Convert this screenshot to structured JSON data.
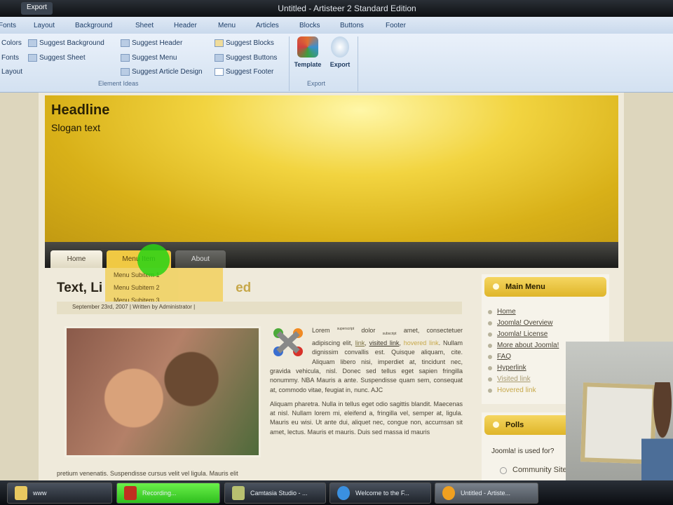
{
  "window": {
    "title": "Untitled - Artisteer 2 Standard Edition",
    "qat_label": "Export"
  },
  "ribbon": {
    "tabs": [
      "Fonts",
      "Layout",
      "Background",
      "Sheet",
      "Header",
      "Menu",
      "Articles",
      "Blocks",
      "Buttons",
      "Footer"
    ],
    "left_items": [
      "Colors",
      "Fonts",
      "Layout"
    ],
    "items": [
      "Suggest Background",
      "Suggest Sheet",
      "Suggest Header",
      "Suggest Menu",
      "Suggest Article Design",
      "Suggest Blocks",
      "Suggest Buttons",
      "Suggest Footer"
    ],
    "group_element_ideas": "Element Ideas",
    "template_label": "Template",
    "export_label": "Export",
    "group_export": "Export"
  },
  "page": {
    "headline": "Headline",
    "slogan": "Slogan text",
    "menu": [
      "Home",
      "Menu Item",
      "About"
    ],
    "submenu": [
      "Menu Subitem 1",
      "Menu Subitem 2",
      "Menu Subitem 3"
    ],
    "article_title_start": "Text, Li",
    "article_title_end": "ed",
    "meta": "September 23rd, 2007 | Written by Administrator |",
    "p1_a": "Lorem ",
    "sup": "superscript",
    "p1_b": " dolor ",
    "sub": "subscript",
    "p1_c": " amet, consectetuer adipiscing elit, ",
    "link": "link",
    "p1_d": ", ",
    "visited": "visited link",
    "p1_e": ", ",
    "hovered": "hovered link",
    "p1_f": ". Nullam dignissim convallis est. Quisque aliquam, cite. Aliquam libero nisi, imperdiet at, tincidunt nec, gravida vehicula, nisl. Donec sed tellus eget sapien fringilla nonummy. NBA Mauris a ante. Suspendisse quam sem, consequat at, commodo vitae, feugiat in, nunc. AJC",
    "p2": "Aliquam pharetra. Nulla in tellus eget odio sagittis blandit. Maecenas at nisl. Nullam lorem mi, eleifend a, fringilla vel, semper at, ligula. Mauris eu wisi. Ut ante dui, aliquet nec, congue non, accumsan sit amet, lectus. Mauris et mauris. Duis sed massa id mauris",
    "p3": "pretium venenatis. Suspendisse cursus velit vel ligula. Mauris elit"
  },
  "sidebar": {
    "main_menu_title": "Main Menu",
    "main_menu": [
      "Home",
      "Joomla! Overview",
      "Joomla! License",
      "More about Joomla!",
      "FAQ",
      "Hyperlink",
      "Visited link",
      "Hovered link"
    ],
    "polls_title": "Polls",
    "poll_question": "Joomla! is used for?",
    "poll_option": "Community Sites"
  },
  "taskbar": {
    "items": [
      "www",
      "Recording...",
      "Camtasia Studio - ...",
      "Welcome to the F...",
      "Untitled - Artiste..."
    ]
  }
}
